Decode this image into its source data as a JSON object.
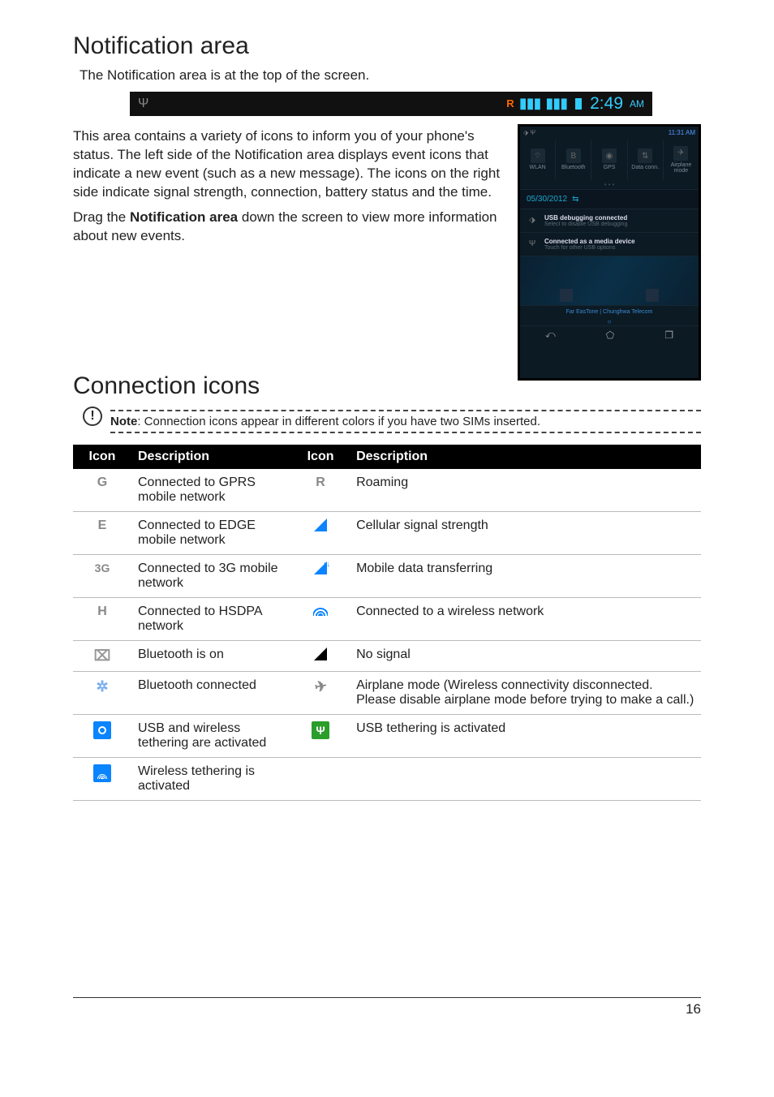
{
  "page_number": "16",
  "sections": {
    "notif_heading": "Notification area",
    "notif_intro": "The Notification area is at the top of the screen.",
    "notif_para1": "This area contains a variety of icons to inform you of your phone's status. The left side of the Notification area displays event icons that indicate a new event (such as a new message). The icons on the right side indicate signal strength, connection, battery status and the time.",
    "notif_para2_a": "Drag the ",
    "notif_para2_b": "Notification area",
    "notif_para2_c": " down the screen to view more information about new events.",
    "conn_heading": "Connection icons"
  },
  "statusbar": {
    "time": "2:49",
    "ampm": "AM"
  },
  "phone": {
    "status_right": "11:31 AM",
    "toggles": {
      "wlan": "WLAN",
      "bluetooth": "Bluetooth",
      "gps": "GPS",
      "data": "Data conn.",
      "airplane": "Airplane mode"
    },
    "date": "05/30/2012",
    "item1_t": "USB debugging connected",
    "item1_s": "Select to disable USB debugging",
    "item2_t": "Connected as a media device",
    "item2_s": "Touch for other USB options",
    "sim_line": "Far EasTone   |   Chunghwa Telecom"
  },
  "note": {
    "label": "Note",
    "text": ": Connection icons appear in different colors if you have two SIMs inserted."
  },
  "table": {
    "hdr_icon": "Icon",
    "hdr_desc": "Description",
    "rows": {
      "r0l": "G",
      "r0ld": "Connected to GPRS mobile network",
      "r0r": "R",
      "r0rd": "Roaming",
      "r1l": "E",
      "r1ld": "Connected to EDGE mobile network",
      "r1rd": "Cellular signal strength",
      "r2l": "3G",
      "r2ld": "Connected to 3G mobile network",
      "r2rd": "Mobile data transferring",
      "r3l": "H",
      "r3ld": "Connected to HSDPA network",
      "r3rd": "Connected to a wireless network",
      "r4ld": "Bluetooth is on",
      "r4rd": "No signal",
      "r5ld": "Bluetooth connected",
      "r5rd": "Airplane mode (Wireless connectivity disconnected. Please disable airplane mode before trying to make a call.)",
      "r6ld": "USB and wireless tethering are activated",
      "r6rd": "USB tethering is activated",
      "r7ld": "Wireless tethering is activated"
    }
  }
}
